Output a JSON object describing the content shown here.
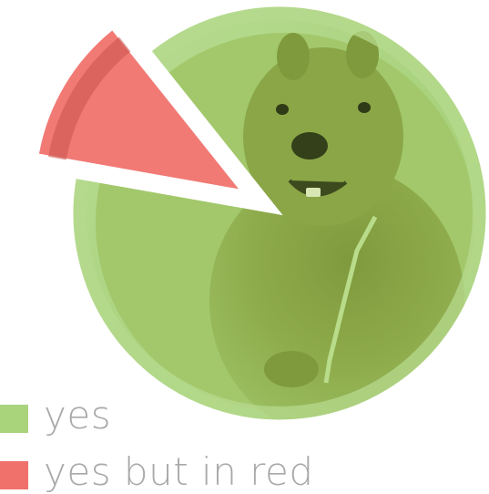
{
  "chart_data": {
    "type": "pie",
    "categories": [
      "yes",
      "yes but in red"
    ],
    "values": [
      88.5,
      11.5
    ],
    "legend": [
      "yes",
      "yes but in red"
    ],
    "legend_position": "bottom-left",
    "exploded_slice": "yes but in red",
    "title": "",
    "colors": {
      "yes": "#a9d47c",
      "yes but in red": "#f0716b"
    }
  },
  "icons": {
    "background_image": "quokka-photo-icon"
  }
}
